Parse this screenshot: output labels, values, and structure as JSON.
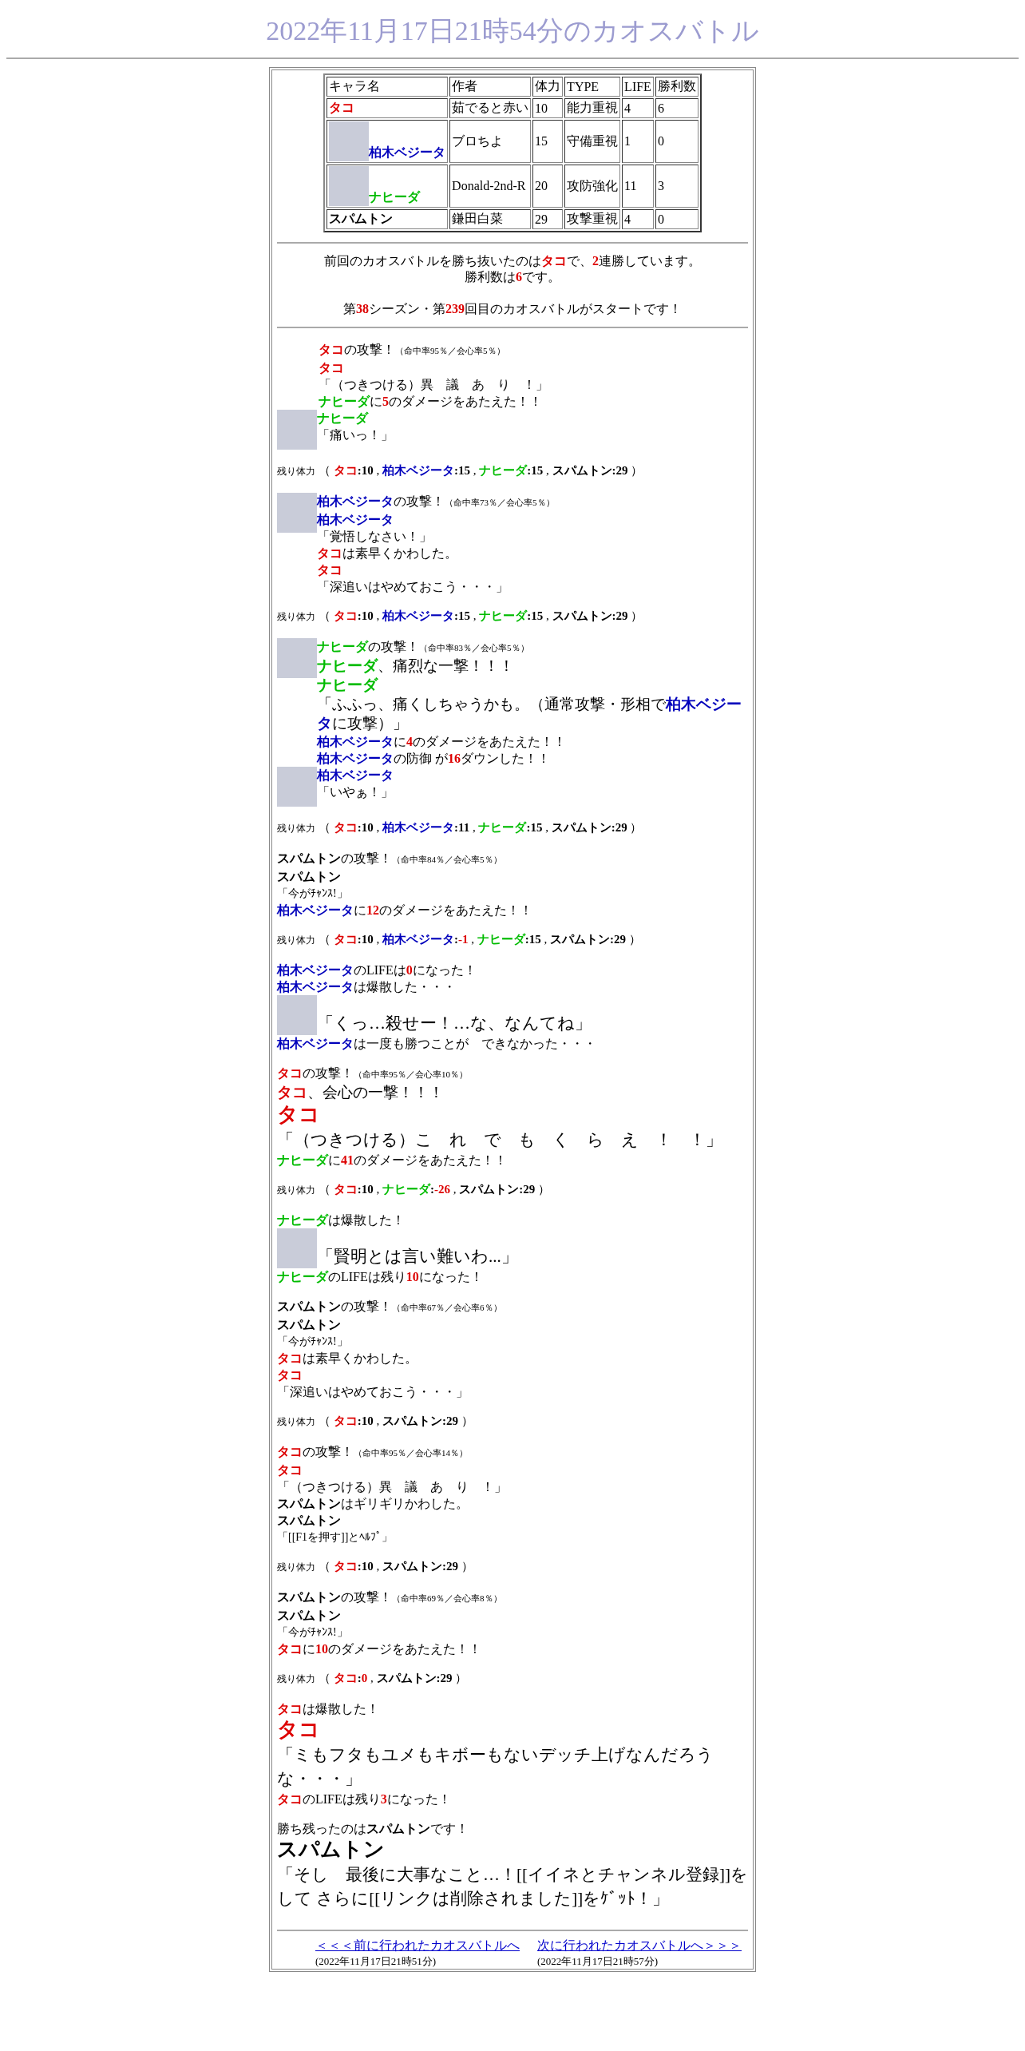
{
  "title": "2022年11月17日21時54分のカオスバトル",
  "table": {
    "columns": [
      "キャラ名",
      "作者",
      "体力",
      "TYPE",
      "LIFE",
      "勝利数"
    ],
    "rows": [
      {
        "name": "タコ",
        "color": "#dd0000",
        "avatar": false,
        "author": "茹でると赤い",
        "hp": "10",
        "type": "能力重視",
        "life": "4",
        "wins": "6"
      },
      {
        "name": "柏木ベジータ",
        "color": "#0000bb",
        "avatar": true,
        "author": "ブロちよ",
        "hp": "15",
        "type": "守備重視",
        "life": "1",
        "wins": "0"
      },
      {
        "name": "ナヒーダ",
        "color": "#00bb00",
        "avatar": true,
        "author": "Donald-2nd-R",
        "hp": "20",
        "type": "攻防強化",
        "life": "11",
        "wins": "3"
      },
      {
        "name": "スパムトン",
        "color": "#000000",
        "avatar": false,
        "author": "鎌田白菜",
        "hp": "29",
        "type": "攻撃重視",
        "life": "4",
        "wins": "0"
      }
    ]
  },
  "intro": [
    [
      {
        "text": "前回のカオスバトルを勝ち抜いたのは"
      },
      {
        "text": "タコ",
        "kind": "name",
        "color": "#dd0000"
      },
      {
        "text": "で、"
      },
      {
        "text": "2",
        "kind": "num"
      },
      {
        "text": "連勝しています。"
      }
    ],
    [
      {
        "text": "勝利数は"
      },
      {
        "text": "6",
        "kind": "num"
      },
      {
        "text": "です。"
      }
    ],
    [
      {
        "text": "第"
      },
      {
        "text": "38",
        "kind": "num"
      },
      {
        "text": "シーズン・第"
      },
      {
        "text": "239",
        "kind": "num"
      },
      {
        "text": "回目のカオスバトルがスタートです！"
      }
    ]
  ],
  "log": [
    {
      "groups": [
        {
          "kind": "indent",
          "lines": [
            {
              "kind": "line",
              "parts": [
                {
                  "text": "タコ",
                  "kind": "name",
                  "color": "#dd0000"
                },
                {
                  "text": "の攻撃！"
                },
                {
                  "text": "（命中率95％／会心率5％）",
                  "kind": "note"
                }
              ]
            },
            {
              "kind": "line",
              "parts": [
                {
                  "text": "タコ",
                  "kind": "name",
                  "color": "#dd0000"
                }
              ]
            },
            {
              "kind": "line",
              "parts": [
                {
                  "text": "「（つきつける）異　議　あ　り　！」"
                }
              ]
            },
            {
              "kind": "line",
              "parts": [
                {
                  "text": "ナヒーダ",
                  "kind": "name",
                  "color": "#00bb00"
                },
                {
                  "text": "に"
                },
                {
                  "text": "5",
                  "kind": "num"
                },
                {
                  "text": "のダメージをあたえた！！"
                }
              ]
            }
          ]
        },
        {
          "kind": "avatar",
          "lines": [
            {
              "kind": "line",
              "parts": [
                {
                  "text": "ナヒーダ",
                  "kind": "name",
                  "color": "#00bb00"
                }
              ]
            },
            {
              "kind": "line",
              "parts": [
                {
                  "text": "「痛いっ！」"
                }
              ]
            }
          ]
        }
      ]
    },
    {
      "groups": [
        {
          "kind": "plain",
          "lines": [
            {
              "kind": "hp",
              "parts": [
                {
                  "text": "残り体力",
                  "kind": "label"
                },
                {
                  "text": "（ "
                },
                {
                  "text": "タコ",
                  "kind": "name",
                  "color": "#dd0000"
                },
                {
                  "text": ":10",
                  "kind": "stat"
                },
                {
                  "text": " , "
                },
                {
                  "text": "柏木ベジータ",
                  "kind": "name",
                  "color": "#0000bb"
                },
                {
                  "text": ":15",
                  "kind": "stat"
                },
                {
                  "text": " , "
                },
                {
                  "text": "ナヒーダ",
                  "kind": "name",
                  "color": "#00bb00"
                },
                {
                  "text": ":15",
                  "kind": "stat"
                },
                {
                  "text": " , "
                },
                {
                  "text": "スパムトン",
                  "kind": "name",
                  "color": "#000000"
                },
                {
                  "text": ":29",
                  "kind": "stat"
                },
                {
                  "text": " ）"
                }
              ]
            }
          ]
        }
      ]
    },
    {
      "groups": [
        {
          "kind": "avatar",
          "lines": [
            {
              "kind": "line",
              "parts": [
                {
                  "text": "柏木ベジータ",
                  "kind": "name",
                  "color": "#0000bb"
                },
                {
                  "text": "の攻撃！"
                },
                {
                  "text": "（命中率73％／会心率5％）",
                  "kind": "note"
                }
              ]
            },
            {
              "kind": "line",
              "parts": [
                {
                  "text": "柏木ベジータ",
                  "kind": "name",
                  "color": "#0000bb"
                }
              ]
            },
            {
              "kind": "line",
              "parts": [
                {
                  "text": "「覚悟しなさい！」"
                }
              ]
            },
            {
              "kind": "line",
              "parts": [
                {
                  "text": "タコ",
                  "kind": "name",
                  "color": "#dd0000"
                },
                {
                  "text": "は素早くかわした。"
                }
              ]
            },
            {
              "kind": "line",
              "parts": [
                {
                  "text": "タコ",
                  "kind": "name",
                  "color": "#dd0000"
                }
              ]
            },
            {
              "kind": "line",
              "parts": [
                {
                  "text": "「深追いはやめておこう・・・」"
                }
              ]
            }
          ]
        }
      ]
    },
    {
      "groups": [
        {
          "kind": "plain",
          "lines": [
            {
              "kind": "hp",
              "parts": [
                {
                  "text": "残り体力",
                  "kind": "label"
                },
                {
                  "text": "（ "
                },
                {
                  "text": "タコ",
                  "kind": "name",
                  "color": "#dd0000"
                },
                {
                  "text": ":10",
                  "kind": "stat"
                },
                {
                  "text": " , "
                },
                {
                  "text": "柏木ベジータ",
                  "kind": "name",
                  "color": "#0000bb"
                },
                {
                  "text": ":15",
                  "kind": "stat"
                },
                {
                  "text": " , "
                },
                {
                  "text": "ナヒーダ",
                  "kind": "name",
                  "color": "#00bb00"
                },
                {
                  "text": ":15",
                  "kind": "stat"
                },
                {
                  "text": " , "
                },
                {
                  "text": "スパムトン",
                  "kind": "name",
                  "color": "#000000"
                },
                {
                  "text": ":29",
                  "kind": "stat"
                },
                {
                  "text": " ）"
                }
              ]
            }
          ]
        }
      ]
    },
    {
      "groups": [
        {
          "kind": "avatar",
          "lines": [
            {
              "kind": "line",
              "parts": [
                {
                  "text": "ナヒーダ",
                  "kind": "name",
                  "color": "#00bb00"
                },
                {
                  "text": "の攻撃！"
                },
                {
                  "text": "（命中率83％／会心率5％）",
                  "kind": "note"
                }
              ]
            },
            {
              "kind": "large",
              "parts": [
                {
                  "text": "ナヒーダ",
                  "kind": "name",
                  "color": "#00bb00"
                },
                {
                  "text": "、痛烈な一撃！！！"
                }
              ]
            },
            {
              "kind": "large",
              "parts": [
                {
                  "text": "ナヒーダ",
                  "kind": "name",
                  "color": "#00bb00"
                }
              ]
            },
            {
              "kind": "large",
              "parts": [
                {
                  "text": "「ふふっ、痛くしちゃうかも。（通常攻撃・形相で"
                },
                {
                  "text": "柏木ベジータ",
                  "kind": "name",
                  "color": "#0000bb"
                },
                {
                  "text": "に攻撃）」"
                }
              ]
            },
            {
              "kind": "line",
              "parts": [
                {
                  "text": "柏木ベジータ",
                  "kind": "name",
                  "color": "#0000bb"
                },
                {
                  "text": "に"
                },
                {
                  "text": "4",
                  "kind": "num"
                },
                {
                  "text": "のダメージをあたえた！！"
                }
              ]
            },
            {
              "kind": "line",
              "parts": [
                {
                  "text": "柏木ベジータ",
                  "kind": "name",
                  "color": "#0000bb"
                },
                {
                  "text": "の防御 が"
                },
                {
                  "text": "16",
                  "kind": "num"
                },
                {
                  "text": "ダウンした！！"
                }
              ]
            }
          ]
        },
        {
          "kind": "avatar",
          "lines": [
            {
              "kind": "line",
              "parts": [
                {
                  "text": "柏木ベジータ",
                  "kind": "name",
                  "color": "#0000bb"
                }
              ]
            },
            {
              "kind": "line",
              "parts": [
                {
                  "text": "「いやぁ！」"
                }
              ]
            }
          ]
        }
      ]
    },
    {
      "groups": [
        {
          "kind": "plain",
          "lines": [
            {
              "kind": "hp",
              "parts": [
                {
                  "text": "残り体力",
                  "kind": "label"
                },
                {
                  "text": "（ "
                },
                {
                  "text": "タコ",
                  "kind": "name",
                  "color": "#dd0000"
                },
                {
                  "text": ":10",
                  "kind": "stat"
                },
                {
                  "text": " , "
                },
                {
                  "text": "柏木ベジータ",
                  "kind": "name",
                  "color": "#0000bb"
                },
                {
                  "text": ":11",
                  "kind": "stat"
                },
                {
                  "text": " , "
                },
                {
                  "text": "ナヒーダ",
                  "kind": "name",
                  "color": "#00bb00"
                },
                {
                  "text": ":15",
                  "kind": "stat"
                },
                {
                  "text": " , "
                },
                {
                  "text": "スパムトン",
                  "kind": "name",
                  "color": "#000000"
                },
                {
                  "text": ":29",
                  "kind": "stat"
                },
                {
                  "text": " ）"
                }
              ]
            }
          ]
        }
      ]
    },
    {
      "groups": [
        {
          "kind": "plain",
          "lines": [
            {
              "kind": "line",
              "parts": [
                {
                  "text": "スパムトン",
                  "kind": "name",
                  "color": "#000000"
                },
                {
                  "text": "の攻撃！"
                },
                {
                  "text": "（命中率84％／会心率5％）",
                  "kind": "note"
                }
              ]
            },
            {
              "kind": "line",
              "parts": [
                {
                  "text": "スパムトン",
                  "kind": "name",
                  "color": "#000000"
                }
              ]
            },
            {
              "kind": "small",
              "parts": [
                {
                  "text": "「今がﾁｬﾝｽ!」"
                }
              ]
            },
            {
              "kind": "line",
              "parts": [
                {
                  "text": "柏木ベジータ",
                  "kind": "name",
                  "color": "#0000bb"
                },
                {
                  "text": "に"
                },
                {
                  "text": "12",
                  "kind": "num"
                },
                {
                  "text": "のダメージをあたえた！！"
                }
              ]
            }
          ]
        }
      ]
    },
    {
      "groups": [
        {
          "kind": "plain",
          "lines": [
            {
              "kind": "hp",
              "parts": [
                {
                  "text": "残り体力",
                  "kind": "label"
                },
                {
                  "text": "（ "
                },
                {
                  "text": "タコ",
                  "kind": "name",
                  "color": "#dd0000"
                },
                {
                  "text": ":10",
                  "kind": "stat"
                },
                {
                  "text": " , "
                },
                {
                  "text": "柏木ベジータ",
                  "kind": "name",
                  "color": "#0000bb"
                },
                {
                  "text": ":",
                  "kind": "stat"
                },
                {
                  "text": "-1",
                  "kind": "num"
                },
                {
                  "text": " , "
                },
                {
                  "text": "ナヒーダ",
                  "kind": "name",
                  "color": "#00bb00"
                },
                {
                  "text": ":15",
                  "kind": "stat"
                },
                {
                  "text": " , "
                },
                {
                  "text": "スパムトン",
                  "kind": "name",
                  "color": "#000000"
                },
                {
                  "text": ":29",
                  "kind": "stat"
                },
                {
                  "text": " ）"
                }
              ]
            }
          ]
        }
      ]
    },
    {
      "groups": [
        {
          "kind": "plain",
          "lines": [
            {
              "kind": "line",
              "parts": [
                {
                  "text": "柏木ベジータ",
                  "kind": "name",
                  "color": "#0000bb"
                },
                {
                  "text": "のLIFEは"
                },
                {
                  "text": "0",
                  "kind": "num"
                },
                {
                  "text": "になった！"
                }
              ]
            },
            {
              "kind": "line",
              "parts": [
                {
                  "text": "柏木ベジータ",
                  "kind": "name",
                  "color": "#0000bb"
                },
                {
                  "text": "は爆散した・・・"
                }
              ]
            }
          ]
        },
        {
          "kind": "inline_avatar",
          "lines": [
            {
              "kind": "quote_big",
              "parts": [
                {
                  "text": "「くっ…殺せー！…な、なんてね」"
                }
              ]
            }
          ]
        },
        {
          "kind": "plain",
          "lines": [
            {
              "kind": "line",
              "parts": [
                {
                  "text": "柏木ベジータ",
                  "kind": "name",
                  "color": "#0000bb"
                },
                {
                  "text": "は一度も勝つことが　できなかった・・・"
                }
              ]
            }
          ]
        }
      ]
    },
    {
      "groups": [
        {
          "kind": "plain",
          "lines": [
            {
              "kind": "line",
              "parts": [
                {
                  "text": "タコ",
                  "kind": "name",
                  "color": "#dd0000"
                },
                {
                  "text": "の攻撃！"
                },
                {
                  "text": "（命中率95％／会心率10％）",
                  "kind": "note"
                }
              ]
            },
            {
              "kind": "large",
              "parts": [
                {
                  "text": "タコ",
                  "kind": "name",
                  "color": "#dd0000"
                },
                {
                  "text": "、会心の一撃！！！"
                }
              ]
            },
            {
              "kind": "name_big",
              "parts": [
                {
                  "text": "タコ",
                  "kind": "name",
                  "color": "#dd0000"
                }
              ]
            },
            {
              "kind": "quote_big",
              "parts": [
                {
                  "text": "「（つきつける）こ　れ　で　も　く　ら　え　！　！」"
                }
              ]
            },
            {
              "kind": "line",
              "parts": [
                {
                  "text": "ナヒーダ",
                  "kind": "name",
                  "color": "#00bb00"
                },
                {
                  "text": "に"
                },
                {
                  "text": "41",
                  "kind": "num"
                },
                {
                  "text": "のダメージをあたえた！！"
                }
              ]
            }
          ]
        }
      ]
    },
    {
      "groups": [
        {
          "kind": "plain",
          "lines": [
            {
              "kind": "hp",
              "parts": [
                {
                  "text": "残り体力",
                  "kind": "label"
                },
                {
                  "text": "（ "
                },
                {
                  "text": "タコ",
                  "kind": "name",
                  "color": "#dd0000"
                },
                {
                  "text": ":10",
                  "kind": "stat"
                },
                {
                  "text": " , "
                },
                {
                  "text": "ナヒーダ",
                  "kind": "name",
                  "color": "#00bb00"
                },
                {
                  "text": ":",
                  "kind": "stat"
                },
                {
                  "text": "-26",
                  "kind": "num"
                },
                {
                  "text": " , "
                },
                {
                  "text": "スパムトン",
                  "kind": "name",
                  "color": "#000000"
                },
                {
                  "text": ":29",
                  "kind": "stat"
                },
                {
                  "text": " ）"
                }
              ]
            }
          ]
        }
      ]
    },
    {
      "groups": [
        {
          "kind": "plain",
          "lines": [
            {
              "kind": "line",
              "parts": [
                {
                  "text": "ナヒーダ",
                  "kind": "name",
                  "color": "#00bb00"
                },
                {
                  "text": "は爆散した！"
                }
              ]
            }
          ]
        },
        {
          "kind": "inline_avatar",
          "lines": [
            {
              "kind": "quote_big",
              "parts": [
                {
                  "text": "「賢明とは言い難いわ...」"
                }
              ]
            }
          ]
        },
        {
          "kind": "plain",
          "lines": [
            {
              "kind": "line",
              "parts": [
                {
                  "text": "ナヒーダ",
                  "kind": "name",
                  "color": "#00bb00"
                },
                {
                  "text": "のLIFEは残り"
                },
                {
                  "text": "10",
                  "kind": "num"
                },
                {
                  "text": "になった！"
                }
              ]
            }
          ]
        }
      ]
    },
    {
      "groups": [
        {
          "kind": "plain",
          "lines": [
            {
              "kind": "line",
              "parts": [
                {
                  "text": "スパムトン",
                  "kind": "name",
                  "color": "#000000"
                },
                {
                  "text": "の攻撃！"
                },
                {
                  "text": "（命中率67％／会心率6％）",
                  "kind": "note"
                }
              ]
            },
            {
              "kind": "line",
              "parts": [
                {
                  "text": "スパムトン",
                  "kind": "name",
                  "color": "#000000"
                }
              ]
            },
            {
              "kind": "small",
              "parts": [
                {
                  "text": "「今がﾁｬﾝｽ!」"
                }
              ]
            },
            {
              "kind": "line",
              "parts": [
                {
                  "text": "タコ",
                  "kind": "name",
                  "color": "#dd0000"
                },
                {
                  "text": "は素早くかわした。"
                }
              ]
            },
            {
              "kind": "line",
              "parts": [
                {
                  "text": "タコ",
                  "kind": "name",
                  "color": "#dd0000"
                }
              ]
            },
            {
              "kind": "line",
              "parts": [
                {
                  "text": "「深追いはやめておこう・・・」"
                }
              ]
            }
          ]
        }
      ]
    },
    {
      "groups": [
        {
          "kind": "plain",
          "lines": [
            {
              "kind": "hp",
              "parts": [
                {
                  "text": "残り体力",
                  "kind": "label"
                },
                {
                  "text": "（ "
                },
                {
                  "text": "タコ",
                  "kind": "name",
                  "color": "#dd0000"
                },
                {
                  "text": ":10",
                  "kind": "stat"
                },
                {
                  "text": " , "
                },
                {
                  "text": "スパムトン",
                  "kind": "name",
                  "color": "#000000"
                },
                {
                  "text": ":29",
                  "kind": "stat"
                },
                {
                  "text": " ）"
                }
              ]
            }
          ]
        }
      ]
    },
    {
      "groups": [
        {
          "kind": "plain",
          "lines": [
            {
              "kind": "line",
              "parts": [
                {
                  "text": "タコ",
                  "kind": "name",
                  "color": "#dd0000"
                },
                {
                  "text": "の攻撃！"
                },
                {
                  "text": "（命中率95％／会心率14％）",
                  "kind": "note"
                }
              ]
            },
            {
              "kind": "line",
              "parts": [
                {
                  "text": "タコ",
                  "kind": "name",
                  "color": "#dd0000"
                }
              ]
            },
            {
              "kind": "line",
              "parts": [
                {
                  "text": "「（つきつける）異　議　あ　り　！」"
                }
              ]
            },
            {
              "kind": "line",
              "parts": [
                {
                  "text": "スパムトン",
                  "kind": "name",
                  "color": "#000000"
                },
                {
                  "text": "はギリギリかわした。"
                }
              ]
            },
            {
              "kind": "line",
              "parts": [
                {
                  "text": "スパムトン",
                  "kind": "name",
                  "color": "#000000"
                }
              ]
            },
            {
              "kind": "small",
              "parts": [
                {
                  "text": "「[[F1を押す]]とﾍﾙﾌﾟ」"
                }
              ]
            }
          ]
        }
      ]
    },
    {
      "groups": [
        {
          "kind": "plain",
          "lines": [
            {
              "kind": "hp",
              "parts": [
                {
                  "text": "残り体力",
                  "kind": "label"
                },
                {
                  "text": "（ "
                },
                {
                  "text": "タコ",
                  "kind": "name",
                  "color": "#dd0000"
                },
                {
                  "text": ":10",
                  "kind": "stat"
                },
                {
                  "text": " , "
                },
                {
                  "text": "スパムトン",
                  "kind": "name",
                  "color": "#000000"
                },
                {
                  "text": ":29",
                  "kind": "stat"
                },
                {
                  "text": " ）"
                }
              ]
            }
          ]
        }
      ]
    },
    {
      "groups": [
        {
          "kind": "plain",
          "lines": [
            {
              "kind": "line",
              "parts": [
                {
                  "text": "スパムトン",
                  "kind": "name",
                  "color": "#000000"
                },
                {
                  "text": "の攻撃！"
                },
                {
                  "text": "（命中率69％／会心率8％）",
                  "kind": "note"
                }
              ]
            },
            {
              "kind": "line",
              "parts": [
                {
                  "text": "スパムトン",
                  "kind": "name",
                  "color": "#000000"
                }
              ]
            },
            {
              "kind": "small",
              "parts": [
                {
                  "text": "「今がﾁｬﾝｽ!」"
                }
              ]
            },
            {
              "kind": "line",
              "parts": [
                {
                  "text": "タコ",
                  "kind": "name",
                  "color": "#dd0000"
                },
                {
                  "text": "に"
                },
                {
                  "text": "10",
                  "kind": "num"
                },
                {
                  "text": "のダメージをあたえた！！"
                }
              ]
            }
          ]
        }
      ]
    },
    {
      "groups": [
        {
          "kind": "plain",
          "lines": [
            {
              "kind": "hp",
              "parts": [
                {
                  "text": "残り体力",
                  "kind": "label"
                },
                {
                  "text": "（ "
                },
                {
                  "text": "タコ",
                  "kind": "name",
                  "color": "#dd0000"
                },
                {
                  "text": ":",
                  "kind": "stat"
                },
                {
                  "text": "0",
                  "kind": "num"
                },
                {
                  "text": " , "
                },
                {
                  "text": "スパムトン",
                  "kind": "name",
                  "color": "#000000"
                },
                {
                  "text": ":29",
                  "kind": "stat"
                },
                {
                  "text": " ）"
                }
              ]
            }
          ]
        }
      ]
    },
    {
      "groups": [
        {
          "kind": "plain",
          "lines": [
            {
              "kind": "line",
              "parts": [
                {
                  "text": "タコ",
                  "kind": "name",
                  "color": "#dd0000"
                },
                {
                  "text": "は爆散した！"
                }
              ]
            },
            {
              "kind": "name_big",
              "parts": [
                {
                  "text": "タコ",
                  "kind": "name",
                  "color": "#dd0000"
                }
              ]
            },
            {
              "kind": "quote_big",
              "parts": [
                {
                  "text": "「ミもフタもユメもキボーもないデッチ上げなんだろうな・・・」"
                }
              ]
            },
            {
              "kind": "line",
              "parts": [
                {
                  "text": "タコ",
                  "kind": "name",
                  "color": "#dd0000"
                },
                {
                  "text": "のLIFEは残り"
                },
                {
                  "text": "3",
                  "kind": "num"
                },
                {
                  "text": "になった！"
                }
              ]
            }
          ]
        }
      ]
    },
    {
      "groups": [
        {
          "kind": "plain",
          "lines": [
            {
              "kind": "line",
              "parts": [
                {
                  "text": "勝ち残ったのは"
                },
                {
                  "text": "スパムトン",
                  "kind": "name",
                  "color": "#000000"
                },
                {
                  "text": "です！"
                }
              ]
            },
            {
              "kind": "name_big",
              "parts": [
                {
                  "text": "スパムトン",
                  "kind": "name",
                  "color": "#000000"
                }
              ]
            },
            {
              "kind": "quote_big",
              "parts": [
                {
                  "text": "「そし　最後に大事なこと…！[[イイネとチャンネル登録]]をして さらに[[リンクは削除されました]]をｹﾞｯﾄ！」"
                }
              ]
            }
          ]
        }
      ]
    }
  ],
  "footer": [
    {
      "link": "＜＜＜前に行われたカオスバトルへ",
      "date": "(2022年11月17日21時51分)"
    },
    {
      "link": "次に行われたカオスバトルへ＞＞＞",
      "date": "(2022年11月17日21時57分)"
    }
  ]
}
